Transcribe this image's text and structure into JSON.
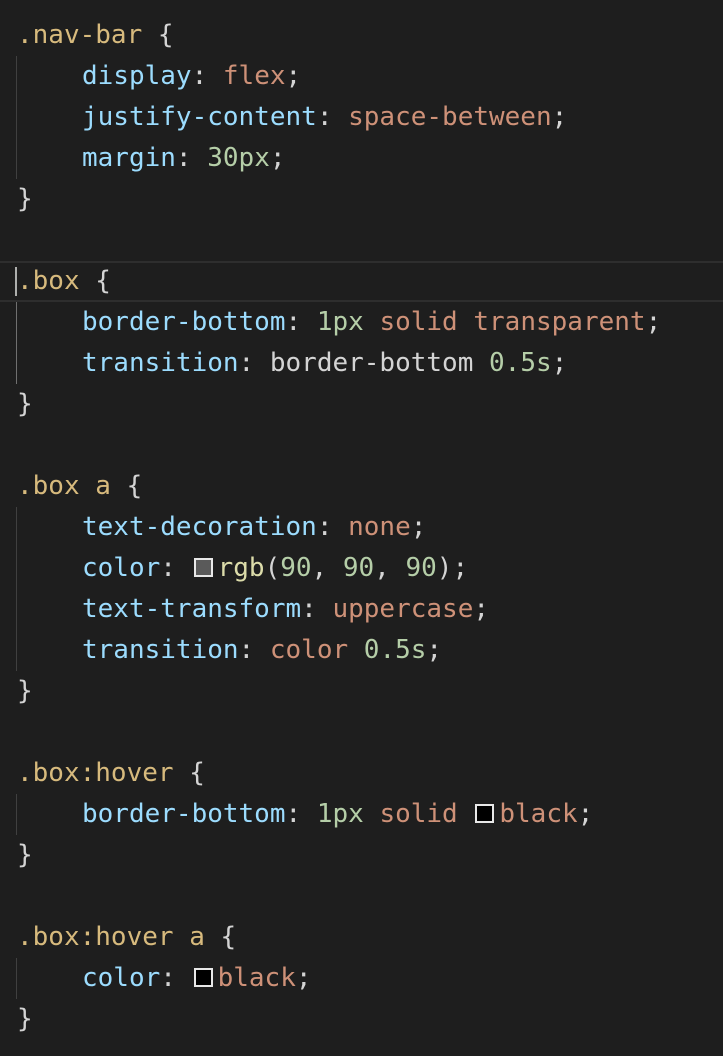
{
  "editor": {
    "colors": {
      "background": "#1e1e1e",
      "selector": "#d7ba7d",
      "property": "#9cdcfe",
      "string_value": "#ce9178",
      "number": "#b5cea8",
      "function": "#dcdcaa",
      "swatch_gray": "#5a5a5a",
      "swatch_black": "#000000"
    },
    "rules": [
      {
        "selector": ".nav-bar",
        "open": " {",
        "close": "}",
        "decls": [
          {
            "prop": "display",
            "sep": ": ",
            "parts": [
              {
                "t": "flex",
                "k": "str"
              }
            ]
          },
          {
            "prop": "justify-content",
            "sep": ": ",
            "parts": [
              {
                "t": "space-between",
                "k": "str"
              }
            ]
          },
          {
            "prop": "margin",
            "sep": ": ",
            "parts": [
              {
                "t": "30px",
                "k": "num"
              }
            ]
          }
        ]
      },
      {
        "selector": ".box",
        "open": " {",
        "close": "}",
        "decls": [
          {
            "prop": "border-bottom",
            "sep": ": ",
            "parts": [
              {
                "t": "1px",
                "k": "num"
              },
              {
                "t": " ",
                "k": "pun"
              },
              {
                "t": "solid",
                "k": "str"
              },
              {
                "t": " ",
                "k": "pun"
              },
              {
                "t": "transparent",
                "k": "str"
              }
            ]
          },
          {
            "prop": "transition",
            "sep": ": ",
            "parts": [
              {
                "t": "border-bottom",
                "k": "pun"
              },
              {
                "t": " ",
                "k": "pun"
              },
              {
                "t": "0.5s",
                "k": "num"
              }
            ]
          }
        ]
      },
      {
        "selector": ".box",
        "tag": " a",
        "open": " {",
        "close": "}",
        "decls": [
          {
            "prop": "text-decoration",
            "sep": ": ",
            "parts": [
              {
                "t": "none",
                "k": "str"
              }
            ]
          },
          {
            "prop": "color",
            "sep": ": ",
            "parts": [
              {
                "swatch": "#5a5a5a"
              },
              {
                "t": "rgb",
                "k": "fn"
              },
              {
                "t": "(",
                "k": "pun"
              },
              {
                "t": "90",
                "k": "num"
              },
              {
                "t": ", ",
                "k": "pun"
              },
              {
                "t": "90",
                "k": "num"
              },
              {
                "t": ", ",
                "k": "pun"
              },
              {
                "t": "90",
                "k": "num"
              },
              {
                "t": ")",
                "k": "pun"
              }
            ]
          },
          {
            "prop": "text-transform",
            "sep": ": ",
            "parts": [
              {
                "t": "uppercase",
                "k": "str"
              }
            ]
          },
          {
            "prop": "transition",
            "sep": ": ",
            "parts": [
              {
                "t": "color",
                "k": "str"
              },
              {
                "t": " ",
                "k": "pun"
              },
              {
                "t": "0.5s",
                "k": "num"
              }
            ]
          }
        ]
      },
      {
        "selector": ".box:hover",
        "open": " {",
        "close": "}",
        "decls": [
          {
            "prop": "border-bottom",
            "sep": ": ",
            "parts": [
              {
                "t": "1px",
                "k": "num"
              },
              {
                "t": " ",
                "k": "pun"
              },
              {
                "t": "solid",
                "k": "str"
              },
              {
                "t": " ",
                "k": "pun"
              },
              {
                "swatch": "#000000"
              },
              {
                "t": "black",
                "k": "str"
              }
            ]
          }
        ]
      },
      {
        "selector": ".box:hover",
        "tag": " a",
        "open": " {",
        "close": "}",
        "decls": [
          {
            "prop": "color",
            "sep": ": ",
            "parts": [
              {
                "swatch": "#000000"
              },
              {
                "t": "black",
                "k": "str"
              }
            ]
          }
        ]
      }
    ],
    "current_rule_index": 1
  }
}
